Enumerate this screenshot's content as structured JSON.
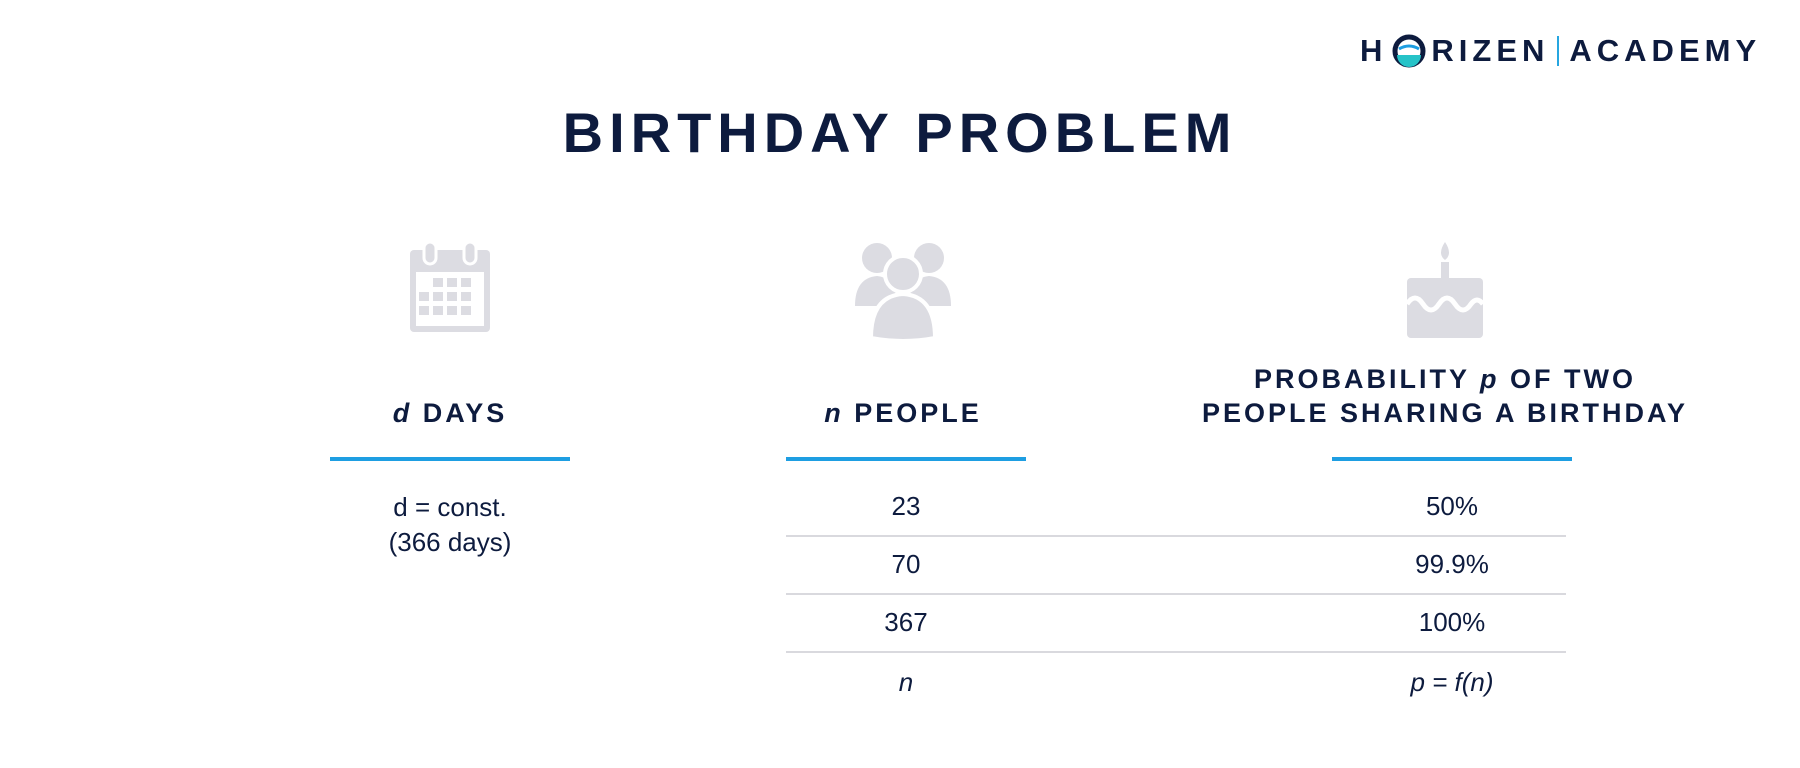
{
  "logo": {
    "left": "H",
    "o": "O",
    "right": "RIZEN",
    "academy": "ACADEMY"
  },
  "title": "BIRTHDAY PROBLEM",
  "columns": {
    "days": {
      "var": "d",
      "label": "DAYS",
      "icon": "calendar-icon"
    },
    "people": {
      "var": "n",
      "label": "PEOPLE",
      "icon": "people-group-icon"
    },
    "probability": {
      "line1_prefix": "PROBABILITY ",
      "var": "p",
      "line1_suffix": " OF TWO",
      "line2": "PEOPLE SHARING A BIRTHDAY",
      "icon": "birthday-cake-icon"
    }
  },
  "days_value": {
    "line1": "d = const.",
    "line2": "(366 days)"
  },
  "rows": [
    {
      "n": "23",
      "p": "50%"
    },
    {
      "n": "70",
      "p": "99.9%"
    },
    {
      "n": "367",
      "p": "100%"
    },
    {
      "n": "n",
      "p": "p = f(n)"
    }
  ],
  "colors": {
    "navy": "#0d1b3e",
    "accent_blue": "#1e9ee2",
    "icon_gray": "#dcdce2",
    "divider": "#d9d9de"
  }
}
